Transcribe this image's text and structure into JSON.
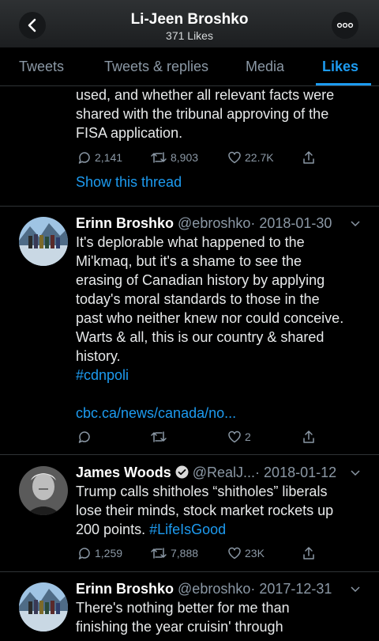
{
  "header": {
    "title": "Li-Jeen Broshko",
    "subtitle": "371 Likes"
  },
  "tabs": [
    "Tweets",
    "Tweets & replies",
    "Media",
    "Likes"
  ],
  "active_tab": "Likes",
  "accent_color": "#1d9bf0",
  "tweet0": {
    "lines": [
      "used, and whether all relevant facts were",
      "shared with the tribunal approving of the",
      "FISA application."
    ],
    "reply_count": "2,141",
    "retweet_count": "8,903",
    "like_count": "22.7K",
    "show_thread": "Show this thread"
  },
  "tweet1": {
    "name": "Erinn Broshko",
    "handle": "@ebroshko",
    "date": "· 2018-01-30",
    "lines": [
      "It's deplorable what happened to the",
      "Mi'kmaq, but it's a shame to see the",
      "erasing of Canadian history by applying",
      "today's moral standards to those in the",
      "past who neither knew nor could conceive.",
      "Warts & all, this is our country & shared",
      "history."
    ],
    "hashtag": "#cdnpoli",
    "link": "cbc.ca/news/canada/no...",
    "like_count": "2"
  },
  "tweet2": {
    "name": "James Woods",
    "handle": "@RealJ...",
    "date": "· 2018-01-12",
    "lines": [
      "Trump calls shitholes “shitholes” liberals",
      "lose their minds, stock market rockets up"
    ],
    "line3": "200 points. ",
    "hashtag": "#LifeIsGood",
    "reply_count": "1,259",
    "retweet_count": "7,888",
    "like_count": "23K"
  },
  "tweet3": {
    "name": "Erinn Broshko",
    "handle": "@ebroshko",
    "date": "· 2017-12-31",
    "lines": [
      "There's nothing better for me than",
      "finishing the year cruisin' through"
    ]
  }
}
